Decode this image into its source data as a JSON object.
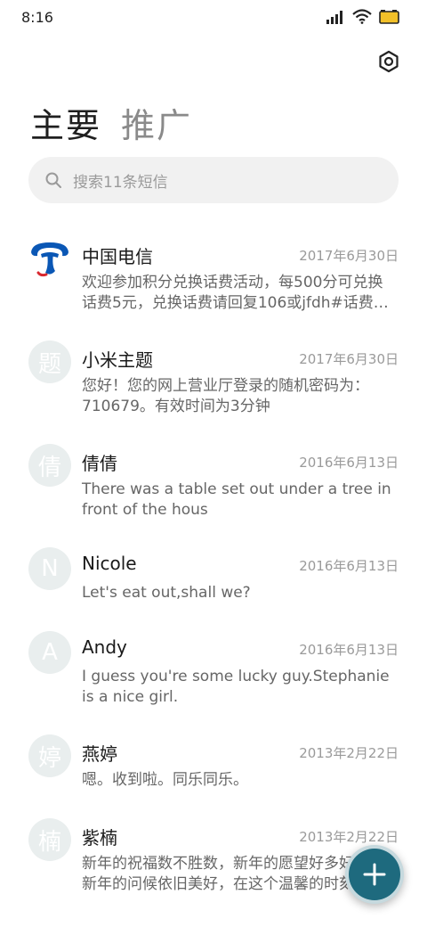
{
  "status_bar": {
    "time": "8:16"
  },
  "tabs": [
    {
      "label": "主要"
    },
    {
      "label": "推广"
    }
  ],
  "search": {
    "placeholder": "搜索11条短信"
  },
  "messages": [
    {
      "avatar": "",
      "avatar_icon": "china-telecom-logo",
      "name": "中国电信",
      "date": "2017年6月30日",
      "snippet": "欢迎参加积分兑换话费活动，每500分可兑换\n话费5元，兑换话费请回复106或jfdh#话费…"
    },
    {
      "avatar": "题",
      "name": "小米主题",
      "date": "2017年6月30日",
      "snippet": "您好！您的网上营业厅登录的随机密码为：\n710679。有效时间为3分钟"
    },
    {
      "avatar": "倩",
      "name": "倩倩",
      "date": "2016年6月13日",
      "snippet": "There was a table set out under a tree in\nfront of the hous"
    },
    {
      "avatar": "N",
      "name": "Nicole",
      "date": "2016年6月13日",
      "snippet": "Let's eat out,shall we?"
    },
    {
      "avatar": "A",
      "name": "Andy",
      "date": "2016年6月13日",
      "snippet": "I guess you're some lucky guy.Stephanie\nis a nice girl."
    },
    {
      "avatar": "婷",
      "name": "燕婷",
      "date": "2013年2月22日",
      "snippet": "嗯。收到啦。同乐同乐。"
    },
    {
      "avatar": "楠",
      "name": "紫楠",
      "date": "2013年2月22日",
      "snippet": "新年的祝福数不胜数，新年的愿望好多好多，\n新年的问候依旧美好，在这个温馨的时刻…"
    }
  ],
  "colors": {
    "accent": "#1e6a7e",
    "telecom_blue": "#0a57b5",
    "battery": "#f2c029"
  }
}
